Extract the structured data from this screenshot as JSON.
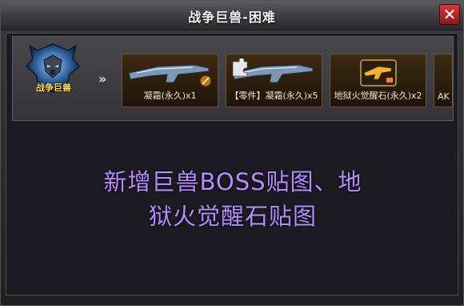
{
  "window": {
    "title": "战争巨兽-困难",
    "close_label": "✕"
  },
  "boss": {
    "name": "战争巨兽",
    "portrait_icon": "armored-beast-icon"
  },
  "rewards_arrow": "»",
  "rewards": [
    {
      "label": "凝霜(永久)x1",
      "icon": "rifle-icon"
    },
    {
      "label": "【零件】凝霜(永久)x5",
      "icon": "rifle-part-icon"
    },
    {
      "label": "地狱火觉醒石(永久)x2",
      "icon": "awakening-stone-icon"
    },
    {
      "label": "AK",
      "icon": "rifle-icon"
    }
  ],
  "notice": {
    "line1": "新增巨兽BOSS贴图、地",
    "line2": "狱火觉醒石贴图"
  },
  "colors": {
    "notice": "#b48cff",
    "boss_label": "#ffd75a",
    "close": "#c62828"
  }
}
